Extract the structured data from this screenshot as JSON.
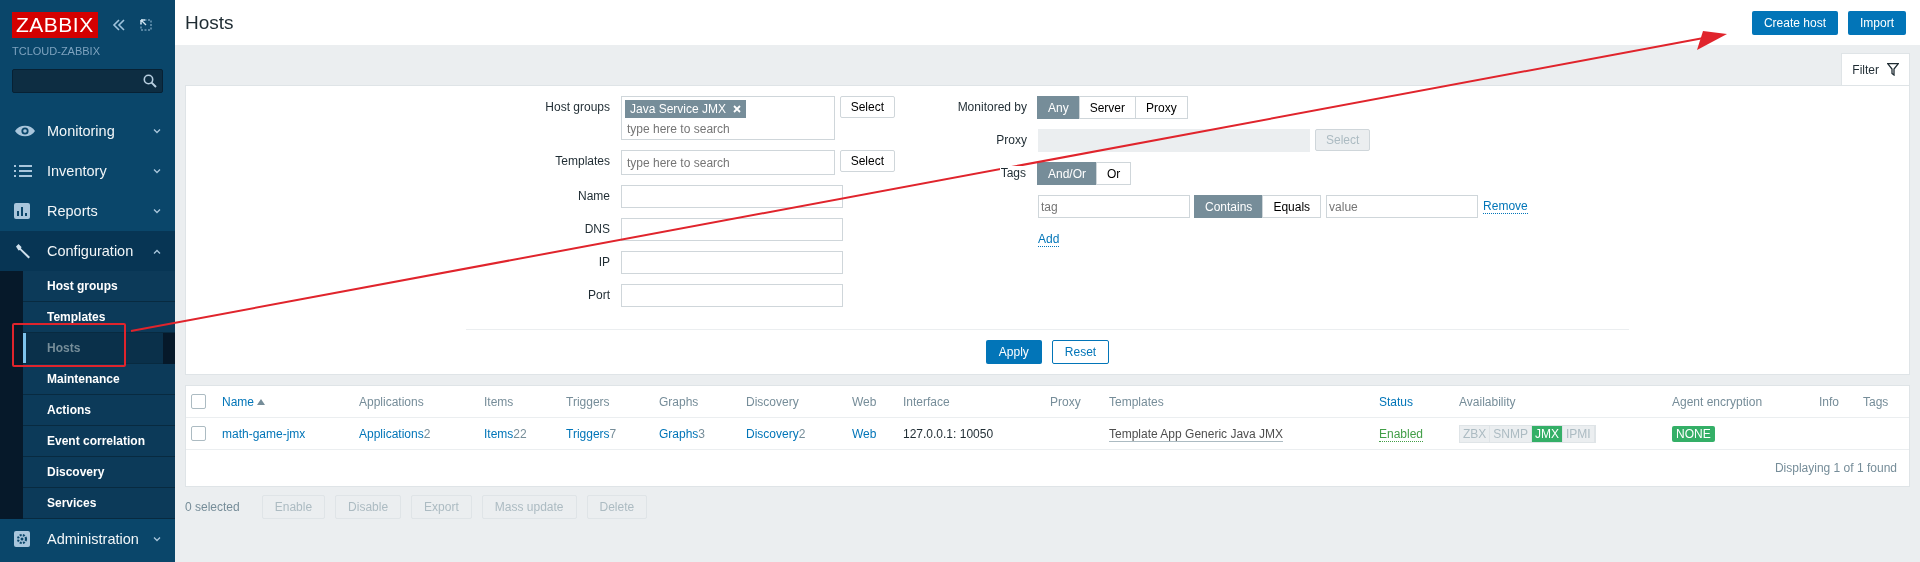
{
  "sidebar": {
    "logo": "ZABBIX",
    "server_name": "TCLOUD-ZABBIX",
    "menu": [
      {
        "label": "Monitoring",
        "expanded": false
      },
      {
        "label": "Inventory",
        "expanded": false
      },
      {
        "label": "Reports",
        "expanded": false
      },
      {
        "label": "Configuration",
        "expanded": true,
        "children": [
          {
            "label": "Host groups",
            "selected": false
          },
          {
            "label": "Templates",
            "selected": false
          },
          {
            "label": "Hosts",
            "selected": true
          },
          {
            "label": "Maintenance",
            "selected": false
          },
          {
            "label": "Actions",
            "selected": false
          },
          {
            "label": "Event correlation",
            "selected": false
          },
          {
            "label": "Discovery",
            "selected": false
          },
          {
            "label": "Services",
            "selected": false
          }
        ]
      },
      {
        "label": "Administration",
        "expanded": false
      }
    ]
  },
  "header": {
    "title": "Hosts",
    "buttons": [
      "Create host",
      "Import"
    ]
  },
  "filter": {
    "tab": "Filter",
    "left_fields": [
      {
        "kind": "multiselect",
        "label": "Host groups",
        "chips": [
          "Java Service JMX"
        ],
        "placeholder": "type here to search",
        "button": "Select"
      },
      {
        "kind": "multiselect",
        "label": "Templates",
        "placeholder": "type here to search",
        "button": "Select"
      },
      {
        "kind": "text",
        "label": "Name"
      },
      {
        "kind": "text",
        "label": "DNS"
      },
      {
        "kind": "text",
        "label": "IP"
      },
      {
        "kind": "text",
        "label": "Port"
      }
    ],
    "monitored_by": {
      "label": "Monitored by",
      "options": [
        {
          "label": "Any",
          "selected": true
        },
        {
          "label": "Server",
          "selected": false
        },
        {
          "label": "Proxy",
          "selected": false
        }
      ]
    },
    "proxy": {
      "label": "Proxy",
      "disabled": true,
      "button": "Select"
    },
    "tags": {
      "label": "Tags",
      "operators": [
        {
          "label": "And/Or",
          "selected": true
        },
        {
          "label": "Or",
          "selected": false
        }
      ],
      "rows": [
        {
          "tag_placeholder": "tag",
          "match": [
            {
              "label": "Contains",
              "selected": true
            },
            {
              "label": "Equals",
              "selected": false
            }
          ],
          "value_placeholder": "value",
          "remove": "Remove"
        }
      ],
      "add": "Add"
    },
    "buttons": [
      {
        "label": "Apply",
        "kind": "primary"
      },
      {
        "label": "Reset",
        "kind": "secondary"
      }
    ]
  },
  "table": {
    "select_all": {
      "checked": false
    },
    "columns": [
      {
        "label": "Name",
        "sortable": true,
        "sorted": true
      },
      {
        "label": "Applications",
        "sortable": false
      },
      {
        "label": "Items",
        "sortable": false
      },
      {
        "label": "Triggers",
        "sortable": false
      },
      {
        "label": "Graphs",
        "sortable": false
      },
      {
        "label": "Discovery",
        "sortable": false
      },
      {
        "label": "Web",
        "sortable": false
      },
      {
        "label": "Interface",
        "sortable": false
      },
      {
        "label": "Proxy",
        "sortable": false
      },
      {
        "label": "Templates",
        "sortable": false
      },
      {
        "label": "Status",
        "sortable": true
      },
      {
        "label": "Availability",
        "sortable": false
      },
      {
        "label": "Agent encryption",
        "sortable": false
      },
      {
        "label": "Info",
        "sortable": false
      },
      {
        "label": "Tags",
        "sortable": false
      }
    ],
    "rows": [
      {
        "checked": false,
        "name": "math-game-jmx",
        "links": [
          {
            "label": "Applications",
            "count": "2"
          },
          {
            "label": "Items",
            "count": "22"
          },
          {
            "label": "Triggers",
            "count": "7"
          },
          {
            "label": "Graphs",
            "count": "3"
          },
          {
            "label": "Discovery",
            "count": "2"
          },
          {
            "label": "Web"
          }
        ],
        "interface": "127.0.0.1: 10050",
        "template": "Template App Generic Java JMX",
        "status": "Enabled",
        "availability": [
          {
            "label": "ZBX",
            "on": false
          },
          {
            "label": "SNMP",
            "on": false
          },
          {
            "label": "JMX",
            "on": true
          },
          {
            "label": "IPMI",
            "on": false
          }
        ],
        "encryption": "NONE"
      }
    ],
    "footer": "Displaying 1 of 1 found"
  },
  "actions": {
    "selected": "0 selected",
    "buttons": [
      {
        "label": "Enable",
        "disabled": true
      },
      {
        "label": "Disable",
        "disabled": true
      },
      {
        "label": "Export",
        "disabled": true
      },
      {
        "label": "Mass update",
        "disabled": true
      },
      {
        "label": "Delete",
        "disabled": true
      }
    ]
  },
  "annotations": {
    "highlight_box": true,
    "arrow": true
  }
}
